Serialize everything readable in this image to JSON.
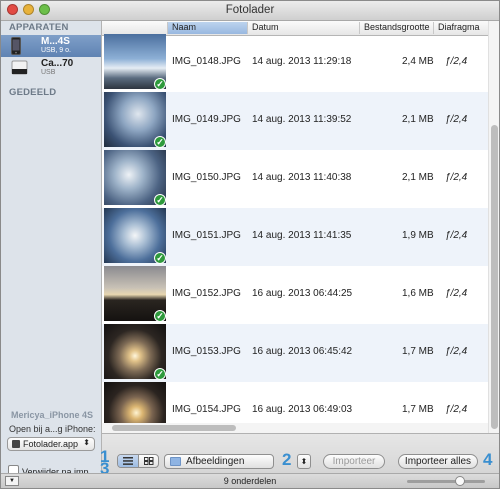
{
  "window": {
    "title": "Fotolader"
  },
  "sidebar": {
    "devices_header": "APPARATEN",
    "shared_header": "GEDEELD",
    "devices": [
      {
        "name": "M...4S",
        "sub": "USB, 9 o.",
        "icon": "iphone-icon",
        "selected": true
      },
      {
        "name": "Ca...70",
        "sub": "USB",
        "icon": "camera-icon",
        "selected": false
      }
    ],
    "device_label": "Mericya_iPhone 4S",
    "open_with_label": "Open bij a...g iPhone:",
    "open_with_app": "Fotolader.app",
    "delete_after_import_label": "Verwijder na imp...",
    "delete_after_import_checked": false
  },
  "columns": {
    "name": "Naam",
    "date": "Datum",
    "size": "Bestandsgrootte",
    "aperture": "Diafragma"
  },
  "photos": [
    {
      "name": "IMG_0148.JPG",
      "date": "14 aug. 2013 11:29:18",
      "size": "2,4 MB",
      "aperture": "ƒ/2,4",
      "imported": true
    },
    {
      "name": "IMG_0149.JPG",
      "date": "14 aug. 2013 11:39:52",
      "size": "2,1 MB",
      "aperture": "ƒ/2,4",
      "imported": true
    },
    {
      "name": "IMG_0150.JPG",
      "date": "14 aug. 2013 11:40:38",
      "size": "2,1 MB",
      "aperture": "ƒ/2,4",
      "imported": true
    },
    {
      "name": "IMG_0151.JPG",
      "date": "14 aug. 2013 11:41:35",
      "size": "1,9 MB",
      "aperture": "ƒ/2,4",
      "imported": true
    },
    {
      "name": "IMG_0152.JPG",
      "date": "16 aug. 2013 06:44:25",
      "size": "1,6 MB",
      "aperture": "ƒ/2,4",
      "imported": true
    },
    {
      "name": "IMG_0153.JPG",
      "date": "16 aug. 2013 06:45:42",
      "size": "1,7 MB",
      "aperture": "ƒ/2,4",
      "imported": true
    },
    {
      "name": "IMG_0154.JPG",
      "date": "16 aug. 2013 06:49:03",
      "size": "1,7 MB",
      "aperture": "ƒ/2,4",
      "imported": true
    }
  ],
  "toolbar": {
    "import_folder": "Afbeeldingen",
    "import_button": "Importeer",
    "import_all_button": "Importeer alles"
  },
  "callouts": [
    "1",
    "2",
    "3",
    "4"
  ],
  "status": {
    "item_count": "9 onderdelen",
    "thumbnail_size": 0.7
  },
  "colors": {
    "selection": "#6a8dbd",
    "check": "#2e9a3c",
    "callout": "#3a8fd0"
  }
}
